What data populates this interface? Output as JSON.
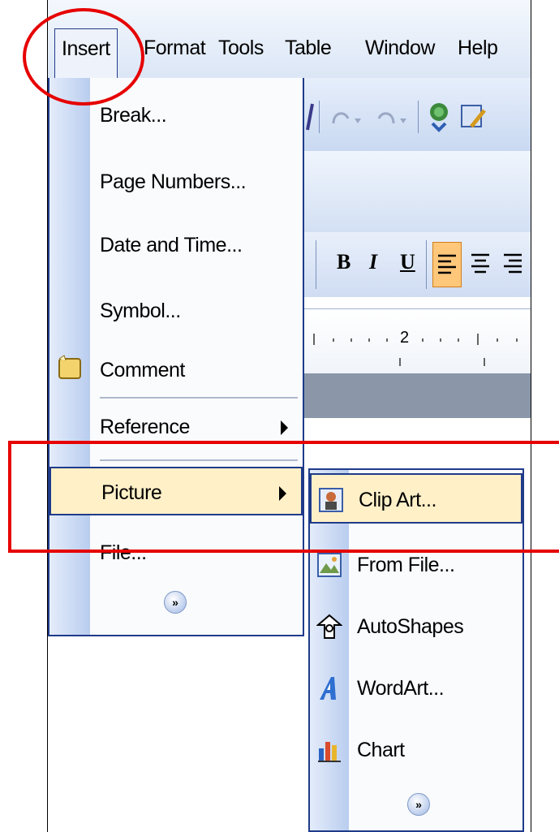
{
  "menubar": {
    "items": [
      "Insert",
      "Format",
      "Tools",
      "Table",
      "Window",
      "Help"
    ]
  },
  "insert_menu": {
    "items": [
      {
        "label": "Break...",
        "has_submenu": false
      },
      {
        "label": "Page Numbers...",
        "has_submenu": false
      },
      {
        "label": "Date and Time...",
        "has_submenu": false
      },
      {
        "label": "Symbol...",
        "has_submenu": false
      },
      {
        "label": "Comment",
        "has_submenu": false,
        "icon": "comment-icon"
      },
      {
        "label": "Reference",
        "has_submenu": true
      },
      {
        "label": "Picture",
        "has_submenu": true,
        "highlighted": true
      },
      {
        "label": "File...",
        "has_submenu": false
      }
    ],
    "expand": "expand-chevron-icon"
  },
  "picture_submenu": {
    "items": [
      {
        "label": "Clip Art...",
        "icon": "clip-art-icon",
        "highlighted": true
      },
      {
        "label": "From File...",
        "icon": "picture-file-icon"
      },
      {
        "label": "AutoShapes",
        "icon": "autoshapes-icon"
      },
      {
        "label": "WordArt...",
        "icon": "wordart-icon"
      },
      {
        "label": "Chart",
        "icon": "chart-icon"
      }
    ],
    "expand": "expand-chevron-icon"
  },
  "formatting_toolbar": {
    "bold": "B",
    "italic": "I",
    "underline": "U"
  },
  "ruler": {
    "mark": "2"
  },
  "colors": {
    "highlight": "#fff0c8",
    "menu_border": "#1f3b8a",
    "annotation": "#e60000"
  }
}
